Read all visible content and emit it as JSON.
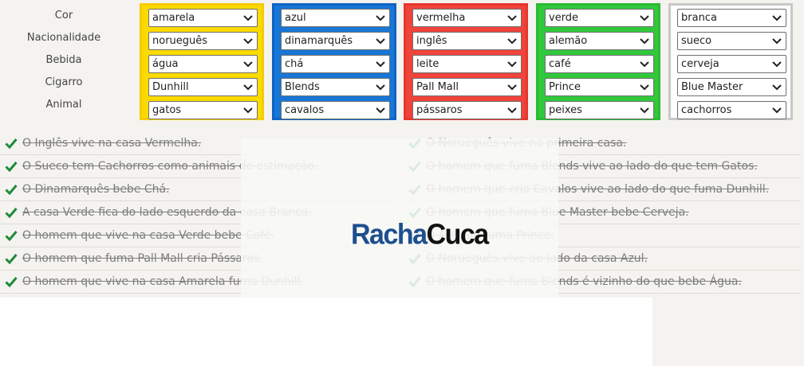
{
  "colors": {
    "house_borders": [
      "#f5cc00",
      "#0f63c4",
      "#e6362e",
      "#2bbb33",
      "#c8c8c8"
    ],
    "house_fills": [
      "#fbda00",
      "#1877d6",
      "#f0433a",
      "#31c83c",
      "#ffffff"
    ],
    "check": "#1f8a3b"
  },
  "labels": [
    "Cor",
    "Nacionalidade",
    "Bebida",
    "Cigarro",
    "Animal"
  ],
  "houses": [
    {
      "values": [
        "amarela",
        "norueguês",
        "água",
        "Dunhill",
        "gatos"
      ]
    },
    {
      "values": [
        "azul",
        "dinamarquês",
        "chá",
        "Blends",
        "cavalos"
      ]
    },
    {
      "values": [
        "vermelha",
        "inglês",
        "leite",
        "Pall Mall",
        "pássaros"
      ]
    },
    {
      "values": [
        "verde",
        "alemão",
        "café",
        "Prince",
        "peixes"
      ]
    },
    {
      "values": [
        "branca",
        "sueco",
        "cerveja",
        "Blue Master",
        "cachorros"
      ]
    }
  ],
  "clues_left": [
    "O Inglês vive na casa Vermelha.",
    "O Sueco tem Cachorros como animais de estimação.",
    "O Dinamarquês bebe Chá.",
    "A casa Verde fica do lado esquerdo da casa Branca.",
    "O homem que vive na casa Verde bebe Café.",
    "O homem que fuma Pall Mall cria Pássaros.",
    "O homem que vive na casa Amarela fuma Dunhill."
  ],
  "clues_right": [
    "O Norueguês vive na primeira casa.",
    "O homem que fuma Blends vive ao lado do que tem Gatos.",
    "O homem que cria Cavalos vive ao lado do que fuma Dunhill.",
    "O homem que fuma Blue Master bebe Cerveja.",
    "O Alemão fuma Prince.",
    "O Norueguês vive ao lado da casa Azul.",
    "O homem que fuma Blends é vizinho do que bebe Água."
  ],
  "logo": {
    "part1": "Racha",
    "part2": "Cuca"
  }
}
